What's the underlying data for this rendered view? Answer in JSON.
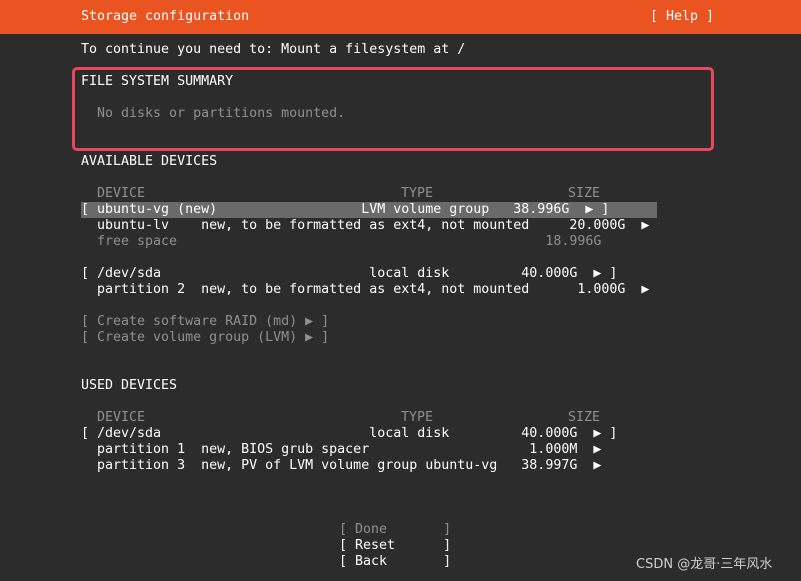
{
  "header": {
    "title": "Storage configuration",
    "help": "[ Help ]",
    "color": "#e95420"
  },
  "intro": "To continue you need to: Mount a filesystem at /",
  "fs_summary": {
    "heading": "FILE SYSTEM SUMMARY",
    "empty_text": "No disks or partitions mounted.",
    "highlight_color": "#e8485c"
  },
  "available": {
    "heading": "AVAILABLE DEVICES",
    "columns": [
      "DEVICE",
      "TYPE",
      "SIZE"
    ],
    "rows": [
      {
        "text": "[ ubuntu-vg (new)                  LVM volume group   38.996G  ▶ ]",
        "selected": true
      },
      {
        "text": "  ubuntu-lv    new, to be formatted as ext4, not mounted     20.000G  ▶"
      },
      {
        "text": "  free space                                              18.996G",
        "dim": true
      },
      {
        "text": "[ /dev/sda                          local disk         40.000G  ▶ ]"
      },
      {
        "text": "  partition 2  new, to be formatted as ext4, not mounted      1.000G  ▶"
      }
    ],
    "actions": [
      "[ Create software RAID (md) ▶ ]",
      "[ Create volume group (LVM) ▶ ]"
    ]
  },
  "used": {
    "heading": "USED DEVICES",
    "columns": [
      "DEVICE",
      "TYPE",
      "SIZE"
    ],
    "rows": [
      {
        "text": "[ /dev/sda                          local disk         40.000G  ▶ ]"
      },
      {
        "text": "  partition 1  new, BIOS grub spacer                    1.000M  ▶"
      },
      {
        "text": "  partition 3  new, PV of LVM volume group ubuntu-vg   38.997G  ▶"
      }
    ]
  },
  "buttons": {
    "done": "[ Done       ]",
    "reset": "[ Reset      ]",
    "back": "[ Back       ]"
  },
  "watermark": "CSDN @龙哥·三年风水"
}
